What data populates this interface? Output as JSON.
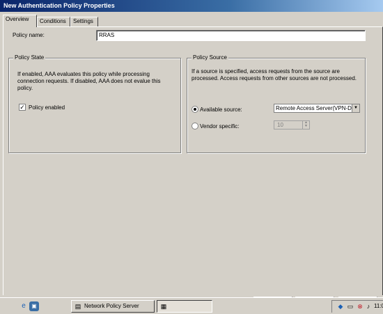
{
  "window": {
    "title": "New Authentication Policy Properties"
  },
  "tabs": [
    "Overview",
    "Conditions",
    "Settings"
  ],
  "policy_name": {
    "label": "Policy name:",
    "value": "RRAS"
  },
  "policy_state": {
    "legend": "Policy State",
    "description": "If enabled, AAA evaluates this policy while processing connection requests. If disabled, AAA does not evalue this policy.",
    "checkbox_label": "Policy enabled",
    "checked": true
  },
  "policy_source": {
    "legend": "Policy Source",
    "description": "If a source is specified, access requests from the source are processed. Access requests from other sources are not processed.",
    "available_label": "Available source:",
    "available_value": "Remote Access Server(VPN-D",
    "vendor_label": "Vendor specific:",
    "vendor_value": "10",
    "selected": "available"
  },
  "taskbar": {
    "tasks": [
      "Network Policy Server",
      ""
    ],
    "clock": "11:0"
  }
}
